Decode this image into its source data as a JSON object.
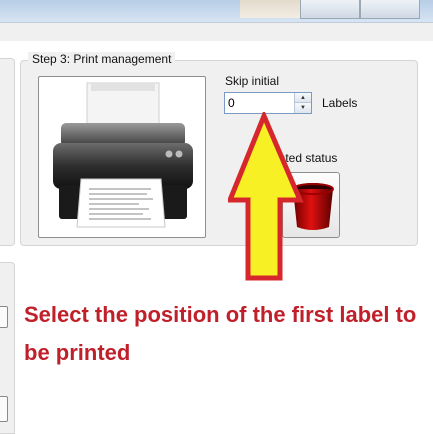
{
  "group": {
    "title": "Step 3: Print management"
  },
  "skip": {
    "label": "Skip initial",
    "value": "0",
    "unit": "Labels"
  },
  "status": {
    "label": "Fix printed status"
  },
  "annotation": {
    "text": "Select the position of the first label to be printed",
    "color": "#c0202a"
  },
  "arrow": {
    "fill": "#f7f024",
    "stroke": "#d6282c"
  },
  "icons": [
    "printer-icon",
    "spin-up-icon",
    "spin-down-icon",
    "trash-bin-icon",
    "up-arrow-icon"
  ]
}
